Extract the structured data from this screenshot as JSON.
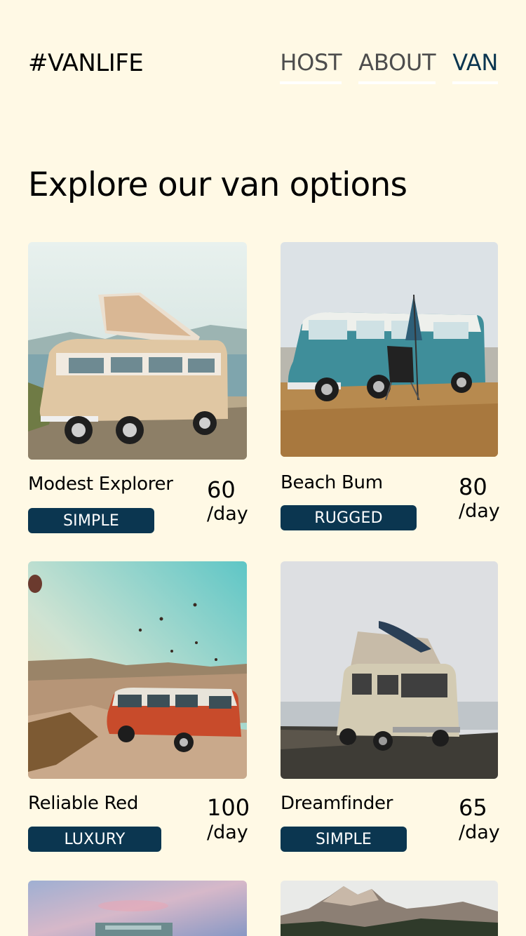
{
  "header": {
    "logo": "#VANLIFE",
    "nav": [
      {
        "label": "HOST",
        "active": false
      },
      {
        "label": "ABOUT",
        "active": false
      },
      {
        "label": "VAN",
        "active": true
      }
    ]
  },
  "main": {
    "title": "Explore our van options",
    "vans": [
      {
        "name": "Modest Explorer",
        "price": "60",
        "unit": "/day",
        "type": "SIMPLE"
      },
      {
        "name": "Beach Bum",
        "price": "80",
        "unit": "/day",
        "type": "RUGGED"
      },
      {
        "name": "Reliable Red",
        "price": "100",
        "unit": "/day",
        "type": "LUXURY"
      },
      {
        "name": "Dreamfinder",
        "price": "65",
        "unit": "/day",
        "type": "SIMPLE"
      }
    ]
  },
  "colors": {
    "background": "#FFF9E5",
    "badge": "#0B3650",
    "nav_active": "#0B3650",
    "nav_inactive": "#4D4D4D"
  }
}
